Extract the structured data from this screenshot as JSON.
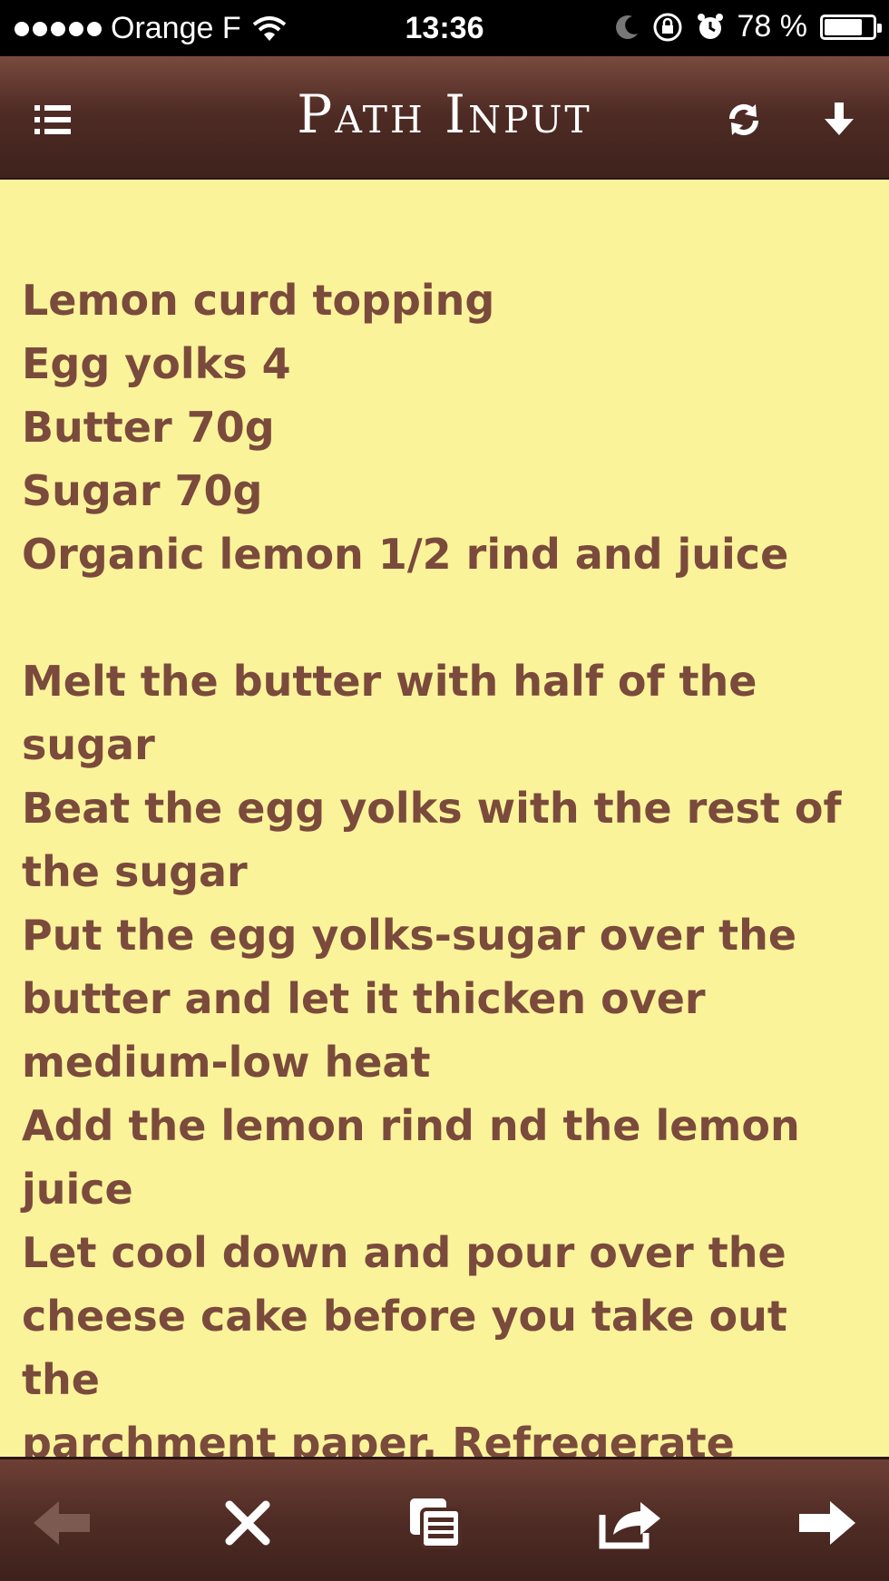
{
  "status_bar": {
    "carrier": "Orange F",
    "time": "13:36",
    "battery_percent": "78 %",
    "battery_level": 0.78,
    "icons": [
      "signal-dots-icon",
      "wifi-icon",
      "moon-icon",
      "rotation-lock-icon",
      "alarm-icon",
      "battery-icon"
    ]
  },
  "navbar": {
    "title": "Path Input",
    "icons": [
      "list-icon",
      "refresh-icon",
      "download-icon"
    ]
  },
  "note": {
    "lines": [
      "Lemon curd topping",
      "Egg yolks 4",
      "Butter 70g",
      "Sugar 70g",
      "Organic lemon 1/2 rind and juice",
      "",
      "Melt the butter with half of the",
      "sugar",
      "Beat the egg yolks with the rest of",
      "the sugar",
      "Put the egg yolks-sugar over the",
      "butter and let it thicken over",
      "medium-low heat",
      "Add the lemon rind nd the lemon juice",
      "Let cool down and pour over the",
      "cheese cake before you take out the",
      "parchment paper. Refregerate"
    ]
  },
  "toolbar": {
    "icons": [
      "back-arrow-icon",
      "close-icon",
      "pages-icon",
      "share-icon",
      "forward-arrow-icon"
    ]
  },
  "colors": {
    "paper": "#fbf39a",
    "ink": "#7a4a3c",
    "bar_leather": "#4f2c25",
    "disabled_icon": "#7c5a52"
  }
}
